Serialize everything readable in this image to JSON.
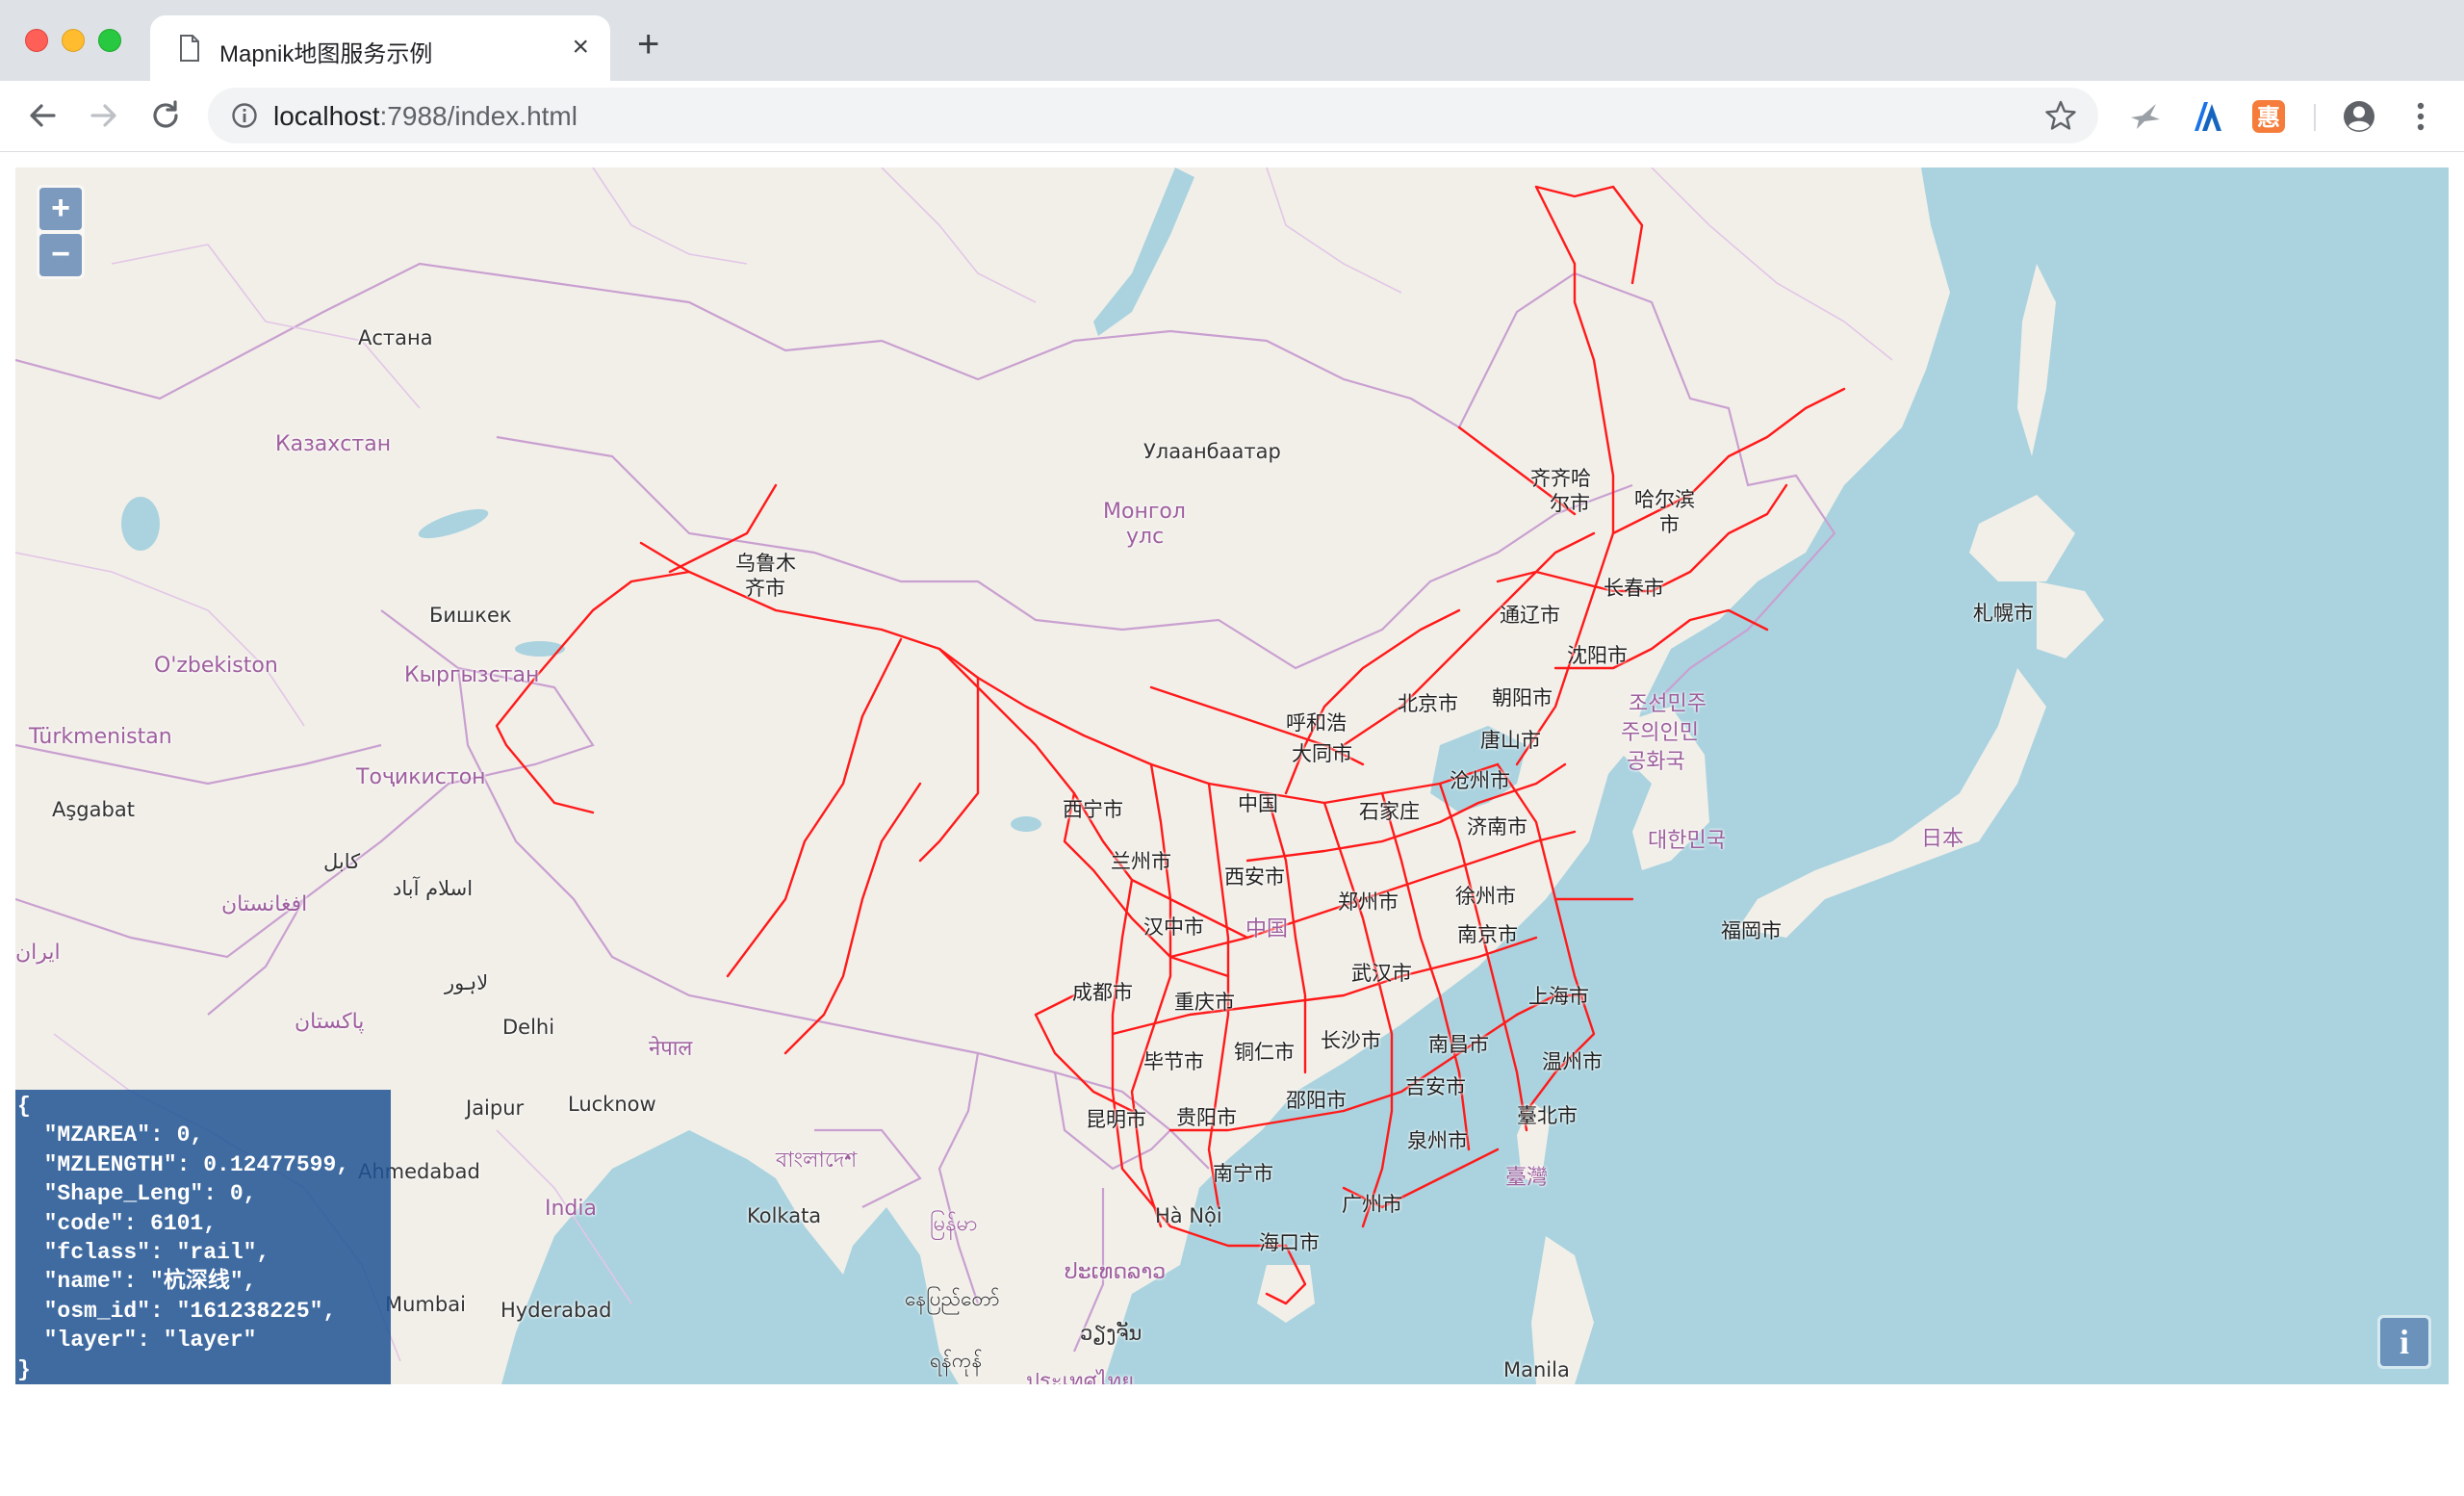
{
  "browser": {
    "tab_title": "Mapnik地图服务示例",
    "tab_close": "×",
    "new_tab": "+",
    "url_host": "localhost",
    "url_rest": ":7988/index.html"
  },
  "map": {
    "zoom_in": "+",
    "zoom_out": "−",
    "attribution": "i",
    "labels": {
      "astana": "Астана",
      "kazakhstan": "Казахстан",
      "ulaanbaatar": "Улаанбаатар",
      "mongol1": "Монгол",
      "mongol2": "улс",
      "bishkek": "Бишкек",
      "kyrgyzstan": "Кыргызстан",
      "uzbekistan": "O'zbekiston",
      "turkmenistan": "Türkmenistan",
      "tajikistan": "Тоҷикистон",
      "ashgabat": "Aşgabat",
      "kabul": "کابل",
      "islamabad": "اسلام آباد",
      "afghanistan": "افغانستان",
      "lahore": "لاہور",
      "pakistan": "پاکستان",
      "delhi": "Delhi",
      "nepal": "नेपाल",
      "jaipur": "Jaipur",
      "lucknow": "Lucknow",
      "ahmedabad": "Ahmedabad",
      "india": "India",
      "bangladesh": "বাংলাদেশ",
      "kolkata": "Kolkata",
      "myanmar": "မြန်မာ",
      "naypyidaw": "နေပြည်တော်",
      "yangon": "ရန်ကုန်",
      "mumbai": "Mumbai",
      "hyderabad": "Hyderabad",
      "thailand": "ประเทศไทย",
      "laos": "ປະເທດລາວ",
      "vientiane": "ວຽງຈັນ",
      "hanoi": "Hà Nội",
      "manila": "Manila",
      "urumqi1": "乌鲁木",
      "urumqi2": "齐市",
      "qiqihar1": "齐齐哈",
      "qiqihar2": "尔市",
      "harbin1": "哈尔滨",
      "harbin2": "市",
      "changchun": "长春市",
      "tongliao": "通辽市",
      "shenyang": "沈阳市",
      "chaoyang": "朝阳市",
      "tangshan": "唐山市",
      "cangzhou": "沧州市",
      "hohhot": "呼和浩",
      "beijing": "北京市",
      "shijiazhuang": "石家庄",
      "xining": "西宁市",
      "lanzhou": "兰州市",
      "xian": "西安市",
      "zhengzhou": "郑州市",
      "xuzhou": "徐州市",
      "nanjing": "南京市",
      "shanghai": "上海市",
      "hanzhong": "汉中市",
      "china": "中国",
      "chengdu": "成都市",
      "chongqing": "重庆市",
      "wuhan": "武汉市",
      "changsha": "长沙市",
      "nanchang": "南昌市",
      "wenzhou": "温州市",
      "bijie": "毕节市",
      "tongren": "铜仁市",
      "shaoyang": "邵阳市",
      "jian": "吉安市",
      "taipei": "臺北市",
      "kunming": "昆明市",
      "guiyang": "贵阳市",
      "quanzhou": "泉州市",
      "taiwan": "臺灣",
      "nanning": "南宁市",
      "guangzhou": "广州市",
      "haikou": "海口市",
      "datong": "大同市",
      "jinan": "济南市",
      "sapporo": "札幌市",
      "nkorea1": "조선민주",
      "nkorea2": "주의인민",
      "nkorea3": "공화국",
      "skorea": "대한민국",
      "japan": "日本",
      "fukuoka": "福岡市",
      "iran": "ایران"
    },
    "feature_popup": {
      "open": "{",
      "lines": [
        "  \"MZAREA\": 0,",
        "  \"MZLENGTH\": 0.12477599,",
        "  \"Shape_Leng\": 0,",
        "  \"code\": 6101,",
        "  \"fclass\": \"rail\",",
        "  \"name\": \"杭深线\",",
        "  \"osm_id\": \"161238225\",",
        "  \"layer\": \"layer\""
      ],
      "close": "}"
    }
  },
  "colors": {
    "sea": "#aad3df",
    "land": "#f2efe9",
    "rail": "#ff1a1a",
    "border": "#c8a0d2"
  }
}
